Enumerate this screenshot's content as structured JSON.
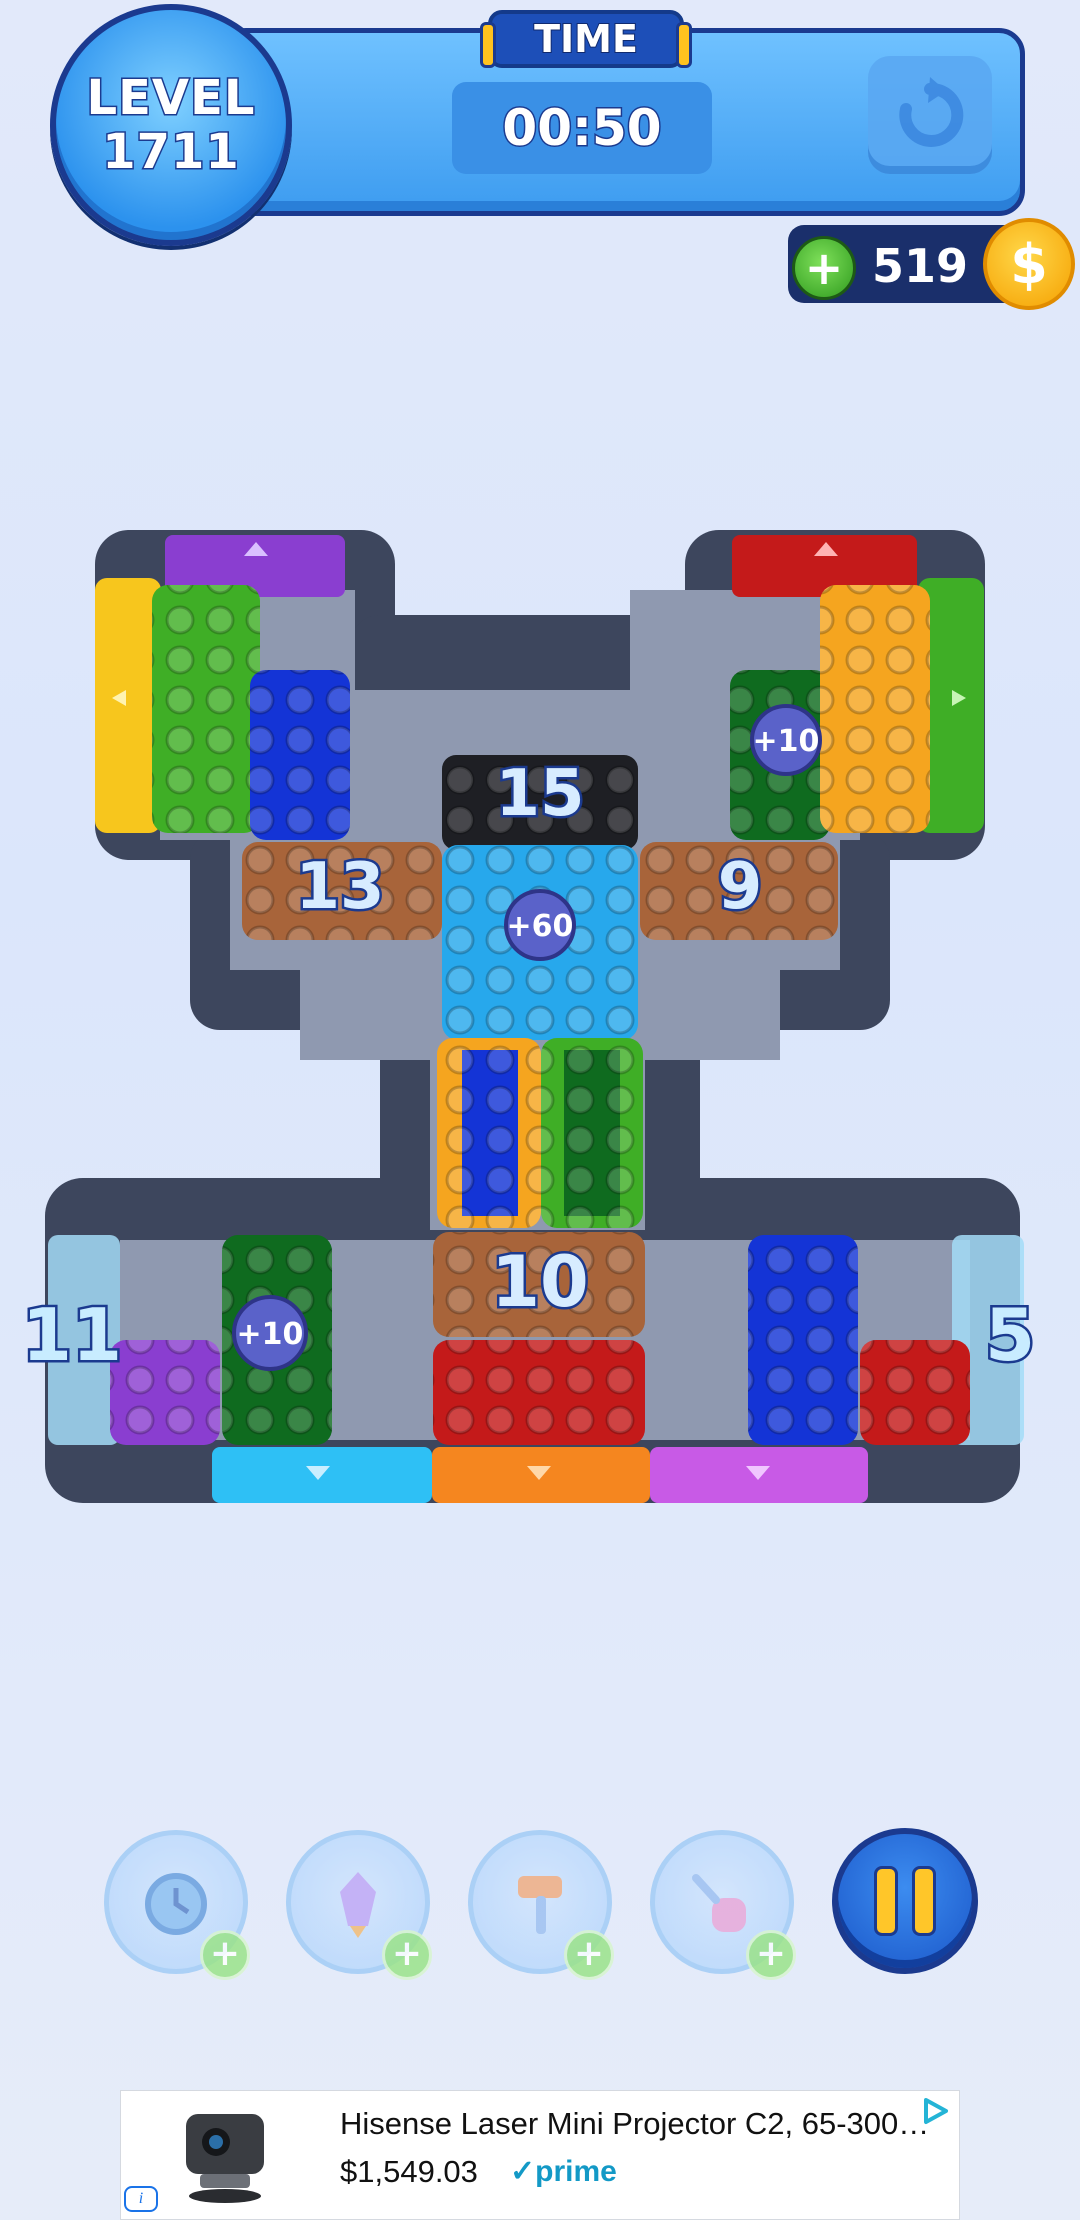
{
  "header": {
    "level_label": "LEVEL",
    "level_number": "1711",
    "time_label": "TIME",
    "timer": "00:50",
    "restart_icon": "restart-icon"
  },
  "coins": {
    "add_icon": "plus-icon",
    "value": "519",
    "coin_icon": "coin-icon",
    "coin_symbol": "$"
  },
  "board": {
    "exit_counters": {
      "left": "11",
      "right": "5"
    },
    "blocks": [
      {
        "id": "black-block",
        "label": "15",
        "color": "#1e1f24"
      },
      {
        "id": "brown-block-left",
        "label": "13",
        "color": "#a8643a"
      },
      {
        "id": "brown-block-right",
        "label": "9",
        "color": "#a8643a"
      },
      {
        "id": "brown-block-bottom",
        "label": "10",
        "color": "#a8643a"
      }
    ],
    "time_bonuses": [
      "+10",
      "+60",
      "+10"
    ],
    "colors": {
      "yellow": "#f7c61d",
      "green": "#3fae26",
      "dark_green": "#0f6b1f",
      "blue": "#1434d6",
      "cyan_blue": "#27a8ec",
      "orange": "#f5a51f",
      "red": "#c41a1a",
      "purple": "#8a3ed0",
      "magenta": "#c85ae6",
      "cyan": "#2ec0f5",
      "frame": "#3d465d",
      "floor": "#8f99b0"
    }
  },
  "powerups": [
    {
      "name": "freeze-clock-powerup",
      "icon": "freeze-clock-icon"
    },
    {
      "name": "rocket-powerup",
      "icon": "rocket-icon"
    },
    {
      "name": "hammer-powerup",
      "icon": "hammer-icon"
    },
    {
      "name": "vacuum-powerup",
      "icon": "vacuum-icon"
    }
  ],
  "powerup_add_symbol": "+",
  "pause": {
    "icon": "pause-icon"
  },
  "ad": {
    "title": "Hisense Laser Mini Projector C2, 65-300…",
    "price": "$1,549.03",
    "badge": "✓prime",
    "info_icon": "i"
  }
}
